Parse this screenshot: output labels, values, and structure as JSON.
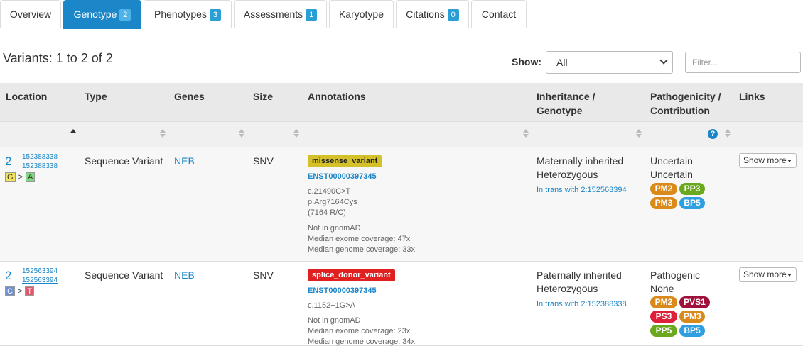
{
  "tabs": [
    {
      "label": "Overview",
      "badge": ""
    },
    {
      "label": "Genotype",
      "badge": "2"
    },
    {
      "label": "Phenotypes",
      "badge": "3"
    },
    {
      "label": "Assessments",
      "badge": "1"
    },
    {
      "label": "Karyotype",
      "badge": ""
    },
    {
      "label": "Citations",
      "badge": "0"
    },
    {
      "label": "Contact",
      "badge": ""
    }
  ],
  "header": {
    "count_text": "Variants: 1 to 2 of 2",
    "show_label": "Show:",
    "show_value": "All",
    "filter_placeholder": "Filter..."
  },
  "table": {
    "columns": {
      "location": "Location",
      "type": "Type",
      "genes": "Genes",
      "size": "Size",
      "annotations": "Annotations",
      "inheritance_1": "Inheritance /",
      "inheritance_2": "Genotype",
      "pathogenicity_1": "Pathogenicity /",
      "pathogenicity_2": "Contribution",
      "links": "Links"
    },
    "help_icon_text": "?",
    "rows": [
      {
        "chr": "2",
        "start": "152388338",
        "end": "152388338",
        "ref": "G",
        "alt": "A",
        "arrow": ">",
        "type": "Sequence Variant",
        "gene": "NEB",
        "size": "SNV",
        "consequence": "missense_variant",
        "transcript": "ENST00000397345",
        "hgvs_c": "c.21490C>T",
        "hgvs_p": "p.Arg7164Cys",
        "protein_change": "(7164 R/C)",
        "gnomad": "Not in gnomAD",
        "exome_cov": "Median exome coverage: 47x",
        "genome_cov": "Median genome coverage: 33x",
        "inheritance": "Maternally inherited",
        "zygosity": "Heterozygous",
        "in_trans": "In trans with 2:152563394",
        "pathogenicity": "Uncertain",
        "contribution": "Uncertain",
        "criteria": [
          "PM2",
          "PP3",
          "PM3",
          "BP5"
        ],
        "show_more": "Show more"
      },
      {
        "chr": "2",
        "start": "152563394",
        "end": "152563394",
        "ref": "C",
        "alt": "T",
        "arrow": ">",
        "type": "Sequence Variant",
        "gene": "NEB",
        "size": "SNV",
        "consequence": "splice_donor_variant",
        "transcript": "ENST00000397345",
        "hgvs_c": "c.1152+1G>A",
        "gnomad": "Not in gnomAD",
        "exome_cov": "Median exome coverage: 23x",
        "genome_cov": "Median genome coverage: 34x",
        "inheritance": "Paternally inherited",
        "zygosity": "Heterozygous",
        "in_trans": "In trans with 2:152388338",
        "pathogenicity": "Pathogenic",
        "contribution": "None",
        "criteria": [
          "PM2",
          "PVS1",
          "PS3",
          "PM3",
          "PP5",
          "BP5"
        ],
        "show_more": "Show more"
      }
    ]
  },
  "colors": {
    "accent": "#1b86c8",
    "missense": "#d4c12a",
    "splice_donor": "#e02020",
    "PM2": "#d98a1a",
    "PM3": "#d98a1a",
    "PP3": "#6aa81e",
    "PP5": "#6aa81e",
    "BP5": "#2f9fe0",
    "PVS1": "#a0103a",
    "PS3": "#e0203a"
  }
}
